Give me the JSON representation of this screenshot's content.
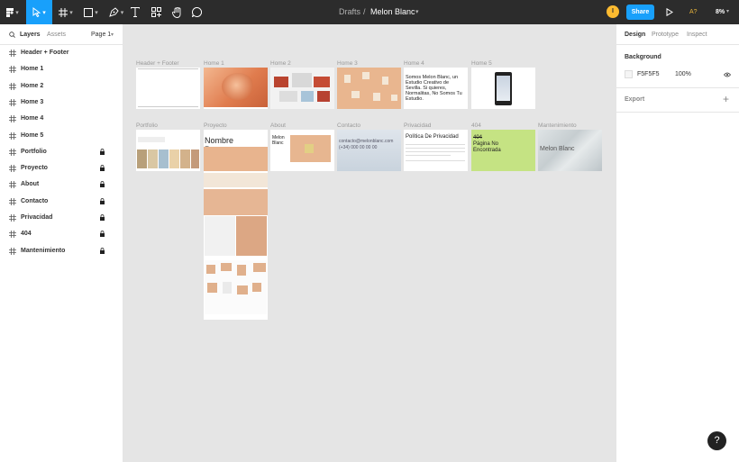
{
  "toolbar": {
    "breadcrumb_parent": "Drafts",
    "breadcrumb_separator": "/",
    "file_name": "Melon Blanc",
    "share_label": "Share",
    "avatar_initial": "I",
    "zoom": "8%",
    "accessibility": "A?"
  },
  "left_panel": {
    "tabs": [
      "Layers",
      "Assets"
    ],
    "page_selector": "Page 1",
    "layers": [
      {
        "label": "Header + Footer",
        "locked": false
      },
      {
        "label": "Home 1",
        "locked": false
      },
      {
        "label": "Home 2",
        "locked": false
      },
      {
        "label": "Home 3",
        "locked": false
      },
      {
        "label": "Home 4",
        "locked": false
      },
      {
        "label": "Home 5",
        "locked": false
      },
      {
        "label": "Portfolio",
        "locked": true
      },
      {
        "label": "Proyecto",
        "locked": true
      },
      {
        "label": "About",
        "locked": true
      },
      {
        "label": "Contacto",
        "locked": true
      },
      {
        "label": "Privacidad",
        "locked": true
      },
      {
        "label": "404",
        "locked": true
      },
      {
        "label": "Mantenimiento",
        "locked": true
      }
    ]
  },
  "right_panel": {
    "tabs": [
      "Design",
      "Prototype",
      "Inspect"
    ],
    "background_title": "Background",
    "bg_hex": "F5F5F5",
    "bg_opacity": "100%",
    "export_title": "Export"
  },
  "canvas": {
    "frame_labels": [
      "Header + Footer",
      "Home 1",
      "Home 2",
      "Home 3",
      "Home 4",
      "Home 5",
      "Portfolio",
      "Proyecto",
      "About",
      "Contacto",
      "Privacidad",
      "404",
      "Mantenimiento"
    ],
    "home4_text": "Somos Melon Blanc, un Estudio Creativo de Sevilla. Si quieres, Normalitas, No Somos Tu Estudio.",
    "proyecto_title": "Nombre Proyecto",
    "about_title": "Melon Blanc",
    "contacto_email": "contacto@melonblanc.com",
    "contacto_phone": "(+34) 000 00 00 00",
    "privacidad_title": "Política De Privacidad",
    "e404_code": "404",
    "e404_title": "Página No Encontrada",
    "mantenimiento_title": "Melon Blanc"
  },
  "help_label": "?",
  "colors": {
    "toolbar": "#2c2c2c",
    "accent": "#18a0fb",
    "canvas": "#e5e5e5",
    "avatar": "#fdbb30",
    "lime": "#c5e383",
    "peach": "#e8a571"
  }
}
